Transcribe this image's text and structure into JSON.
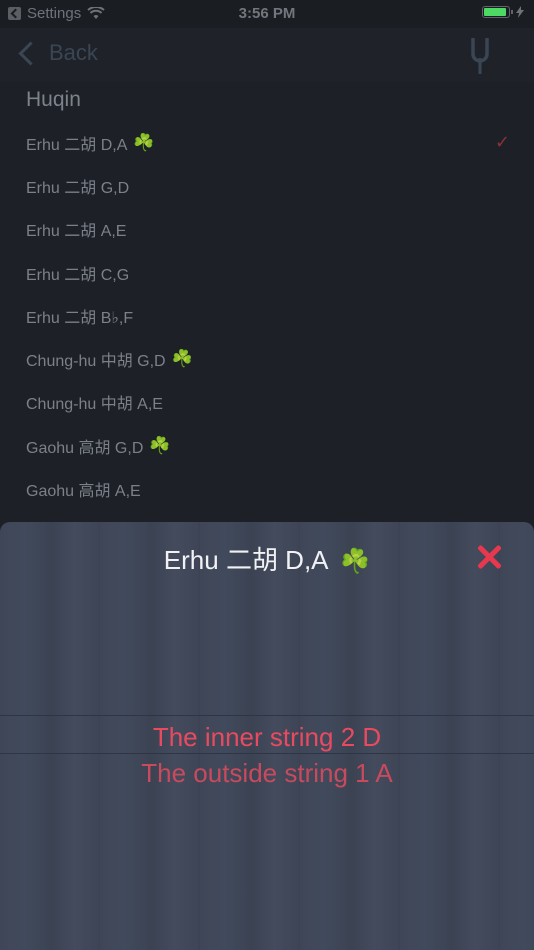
{
  "status_bar": {
    "carrier": "Settings",
    "time": "3:56 PM"
  },
  "nav": {
    "back_label": "Back",
    "right_icon": "tuning-fork-icon"
  },
  "section_title": "Huqin",
  "list": [
    {
      "label": "Erhu 二胡 D,A",
      "clover": "☘️",
      "checked": true
    },
    {
      "label": "Erhu 二胡 G,D",
      "clover": "",
      "checked": false
    },
    {
      "label": "Erhu 二胡 A,E",
      "clover": "",
      "checked": false
    },
    {
      "label": "Erhu 二胡 C,G",
      "clover": "",
      "checked": false
    },
    {
      "label": "Erhu 二胡 B♭,F",
      "clover": "",
      "checked": false
    },
    {
      "label": "Chung-hu 中胡 G,D",
      "clover": "☘️",
      "checked": false
    },
    {
      "label": "Chung-hu 中胡 A,E",
      "clover": "",
      "checked": false
    },
    {
      "label": "Gaohu 高胡 G,D",
      "clover": "☘️",
      "checked": false
    },
    {
      "label": "Gaohu 高胡 A,E",
      "clover": "",
      "checked": false
    }
  ],
  "check_mark": "✓",
  "sheet": {
    "title": "Erhu 二胡 D,A",
    "title_clover": "☘️",
    "inner_string": "The inner string 2 D",
    "outside_string": "The outside string 1 A"
  },
  "colors": {
    "accent_red": "#e7384e",
    "clover_green": "#5fb24a",
    "battery_green": "#4cd964"
  }
}
